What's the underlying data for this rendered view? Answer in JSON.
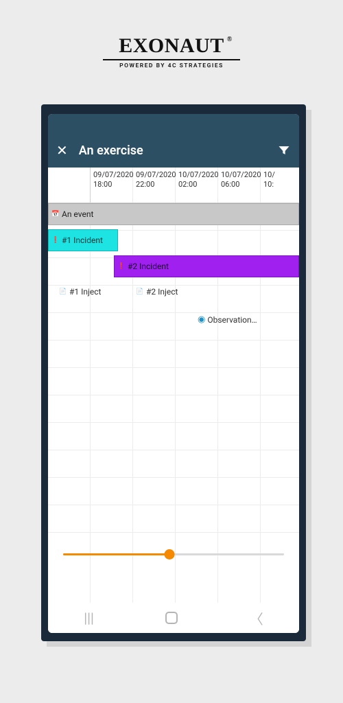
{
  "brand": {
    "name": "EXONAUT",
    "reg": "®",
    "tagline": "POWERED BY 4C STRATEGIES"
  },
  "header": {
    "close": "✕",
    "title": "An exercise"
  },
  "timeline": {
    "columns": [
      {
        "date": "09/07/2020",
        "time": "18:00"
      },
      {
        "date": "09/07/2020",
        "time": "22:00"
      },
      {
        "date": "10/07/2020",
        "time": "02:00"
      },
      {
        "date": "10/07/2020",
        "time": "06:00"
      },
      {
        "date": "10/",
        "time": "10:"
      }
    ]
  },
  "items": {
    "event": "An event",
    "incident1": "#1 Incident",
    "incident2": "#2 Incident",
    "inject1": "#1 Inject",
    "inject2": "#2 Inject",
    "observation": "Observation…"
  },
  "slider": {
    "percent": 48
  }
}
